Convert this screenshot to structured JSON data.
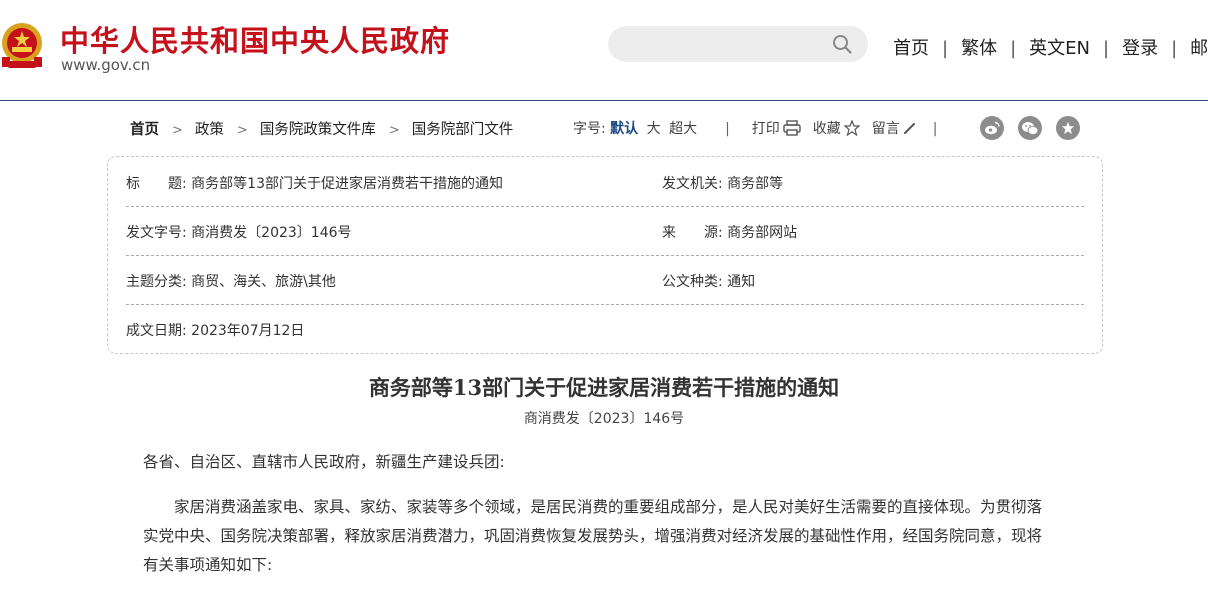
{
  "header": {
    "site_title": "中华人民共和国中央人民政府",
    "site_url": "www.gov.cn",
    "search_placeholder": "",
    "nav": [
      "首页",
      "繁体",
      "英文EN",
      "登录",
      "邮箱"
    ]
  },
  "breadcrumb": [
    "首页",
    "政策",
    "国务院政策文件库",
    "国务院部门文件"
  ],
  "tools": {
    "font_label": "字号:",
    "font_default": "默认",
    "font_large": "大",
    "font_xlarge": "超大",
    "print": "打印",
    "favorite": "收藏",
    "comment": "留言"
  },
  "share_icons": [
    "weibo-icon",
    "wechat-icon",
    "favorite-star-icon"
  ],
  "meta": {
    "title_label": "标　　题:",
    "title_value": "商务部等13部门关于促进家居消费若干措施的通知",
    "issuer_label": "发文机关:",
    "issuer_value": "商务部等",
    "doc_no_label": "发文字号:",
    "doc_no_value": "商消费发〔2023〕146号",
    "source_label": "来　　源:",
    "source_value": "商务部网站",
    "topic_label": "主题分类:",
    "topic_value": "商贸、海关、旅游\\其他",
    "type_label": "公文种类:",
    "type_value": "通知",
    "date_label": "成文日期:",
    "date_value": "2023年07月12日"
  },
  "article": {
    "title": "商务部等13部门关于促进家居消费若干措施的通知",
    "doc_no": "商消费发〔2023〕146号",
    "salutation": "各省、自治区、直辖市人民政府，新疆生产建设兵团:",
    "para1_line1": "　　家居消费涵盖家电、家具、家纺、家装等多个领域，是居民消费的重要组成部分，是人民对美好生活需要的直接体现。为贯彻落",
    "para1_line2": "实党中央、国务院决策部署，释放家居消费潜力，巩固消费恢复发展势头，增强消费对经济发展的基础性作用，经国务院同意，现将",
    "para1_line3": "有关事项通知如下:"
  },
  "colors": {
    "brand_red": "#c4111a",
    "header_rule": "#2f4e7e",
    "active_font": "#1b4a84",
    "share_grey": "#8c8c8c"
  }
}
